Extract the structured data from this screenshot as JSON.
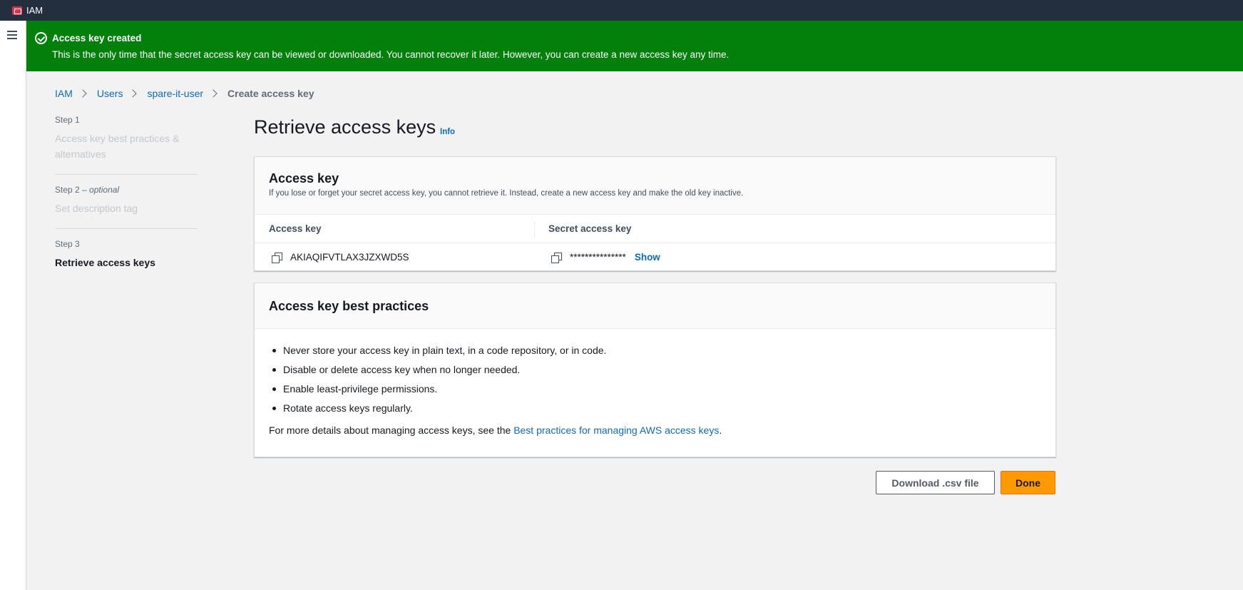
{
  "topbar": {
    "service_name": "IAM",
    "service_icon": "iam-service-icon"
  },
  "flash": {
    "title": "Access key created",
    "message": "This is the only time that the secret access key can be viewed or downloaded. You cannot recover it later. However, you can create a new access key any time.",
    "color": "#037f0c"
  },
  "breadcrumb": {
    "items": [
      "IAM",
      "Users",
      "spare-it-user"
    ],
    "current": "Create access key"
  },
  "steps": [
    {
      "label": "Step 1",
      "optional": "",
      "title": "Access key best practices & alternatives"
    },
    {
      "label": "Step 2",
      "optional": "optional",
      "title": "Set description tag"
    },
    {
      "label": "Step 3",
      "optional": "",
      "title": "Retrieve access keys"
    }
  ],
  "page": {
    "title": "Retrieve access keys",
    "info": "Info"
  },
  "access_key_card": {
    "title": "Access key",
    "description": "If you lose or forget your secret access key, you cannot retrieve it. Instead, create a new access key and make the old key inactive.",
    "columns": [
      "Access key",
      "Secret access key"
    ],
    "access_key_id": "AKIAQIFVTLAX3JZXWD5S",
    "secret_masked": "***************",
    "show_label": "Show"
  },
  "best_practices_card": {
    "title": "Access key best practices",
    "items": [
      "Never store your access key in plain text, in a code repository, or in code.",
      "Disable or delete access key when no longer needed.",
      "Enable least-privilege permissions.",
      "Rotate access keys regularly."
    ],
    "more_prefix": "For more details about managing access keys, see the ",
    "more_link": "Best practices for managing AWS access keys",
    "more_suffix": "."
  },
  "actions": {
    "download": "Download .csv file",
    "done": "Done"
  },
  "colors": {
    "primary": "#ff9900",
    "link": "#0f6bb5",
    "topbar": "#232f3e"
  }
}
